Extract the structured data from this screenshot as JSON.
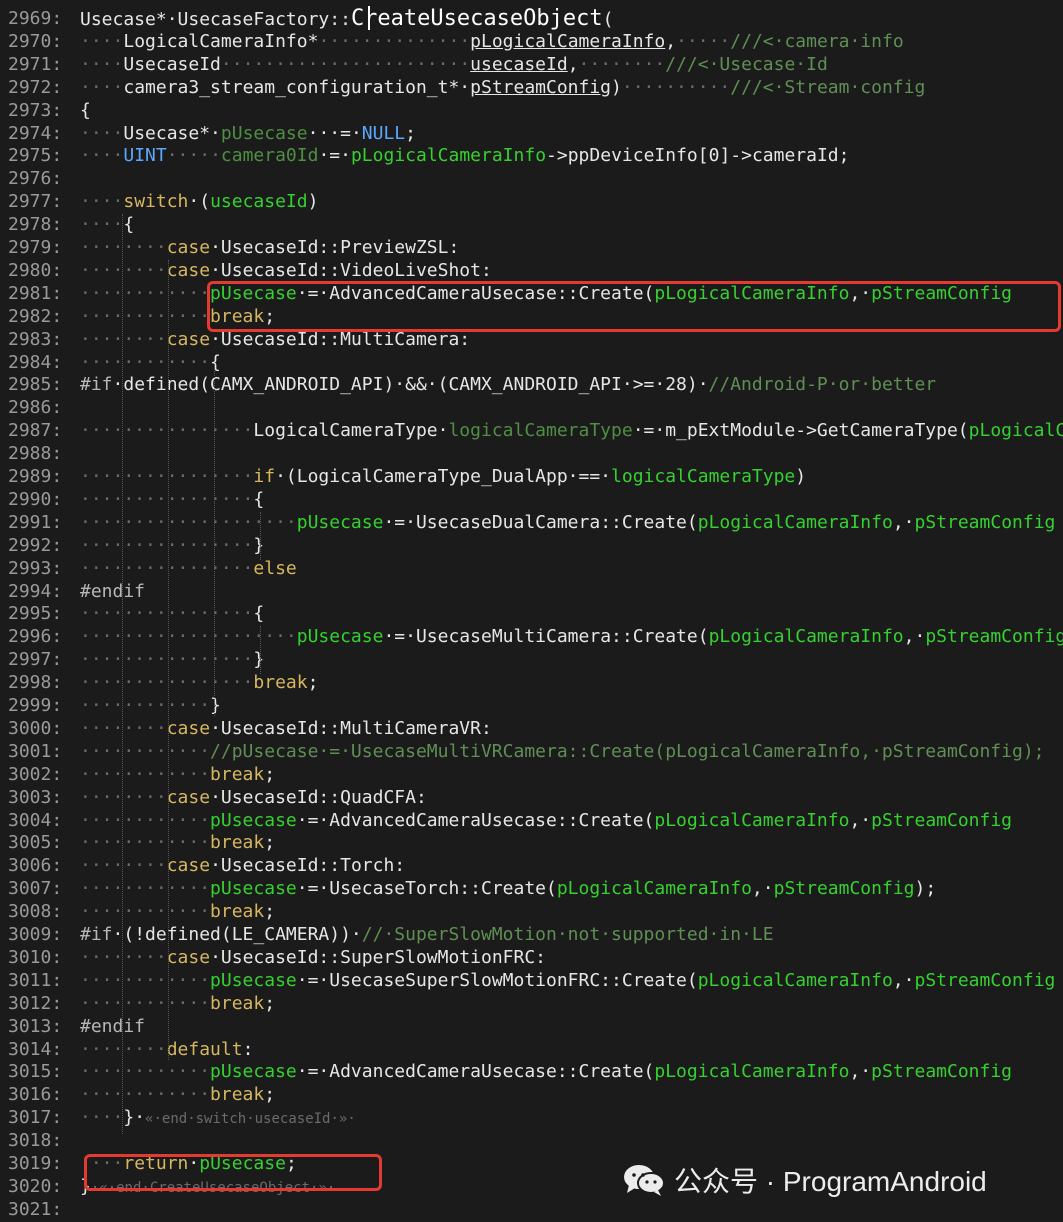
{
  "lines": [
    {
      "n": "2969:",
      "t": [
        [
          "Usecase*·UsecaseFactory::",
          ""
        ],
        [
          "CreateUsecaseObject",
          "t-title"
        ],
        [
          "(",
          ""
        ]
      ]
    },
    {
      "n": "2970:",
      "t": [
        [
          "····",
          "t-ws"
        ],
        [
          "LogicalCameraInfo*",
          ""
        ],
        [
          "··············",
          "t-ws"
        ],
        [
          "pLogicalCameraInfo",
          "t-u"
        ],
        [
          ",",
          ""
        ],
        [
          "·····",
          "t-ws"
        ],
        [
          "///<·camera·info",
          "t-cmt"
        ]
      ]
    },
    {
      "n": "2971:",
      "t": [
        [
          "····",
          "t-ws"
        ],
        [
          "UsecaseId",
          ""
        ],
        [
          "·······················",
          "t-ws"
        ],
        [
          "usecaseId",
          "t-u"
        ],
        [
          ",",
          ""
        ],
        [
          "········",
          "t-ws"
        ],
        [
          "///<·Usecase·Id",
          "t-cmt"
        ]
      ]
    },
    {
      "n": "2972:",
      "t": [
        [
          "····",
          "t-ws"
        ],
        [
          "camera3_stream_configuration_t*·",
          ""
        ],
        [
          "pStreamConfig",
          "t-u"
        ],
        [
          ")",
          ""
        ],
        [
          "··········",
          "t-ws"
        ],
        [
          "///<·Stream·config",
          "t-cmt"
        ]
      ]
    },
    {
      "n": "2973:",
      "t": [
        [
          "{",
          ""
        ]
      ]
    },
    {
      "n": "2974:",
      "t": [
        [
          "····",
          "t-ws"
        ],
        [
          "Usecase*·",
          ""
        ],
        [
          "pUsecase",
          "t-dim"
        ],
        [
          "···=·",
          ""
        ],
        [
          "NULL",
          "t-type"
        ],
        [
          ";",
          ""
        ]
      ]
    },
    {
      "n": "2975:",
      "t": [
        [
          "····",
          "t-ws"
        ],
        [
          "UINT",
          "t-type"
        ],
        [
          "·····",
          "t-ws"
        ],
        [
          "camera0Id",
          "t-dim"
        ],
        [
          "·=·",
          ""
        ],
        [
          "pLogicalCameraInfo",
          "t-var"
        ],
        [
          "->ppDeviceInfo[0]->cameraId;",
          ""
        ]
      ]
    },
    {
      "n": "2976:",
      "t": []
    },
    {
      "n": "2977:",
      "t": [
        [
          "····",
          "t-ws"
        ],
        [
          "switch",
          "t-kw"
        ],
        [
          "·(",
          ""
        ],
        [
          "usecaseId",
          "t-var"
        ],
        [
          ")",
          ""
        ]
      ]
    },
    {
      "n": "2978:",
      "t": [
        [
          "····",
          "t-ws"
        ],
        [
          "{",
          ""
        ]
      ]
    },
    {
      "n": "2979:",
      "t": [
        [
          "········",
          "t-ws"
        ],
        [
          "case",
          "t-kw"
        ],
        [
          "·UsecaseId::PreviewZSL:",
          ""
        ]
      ]
    },
    {
      "n": "2980:",
      "t": [
        [
          "········",
          "t-ws"
        ],
        [
          "case",
          "t-kw"
        ],
        [
          "·UsecaseId::VideoLiveShot:",
          ""
        ]
      ]
    },
    {
      "n": "2981:",
      "t": [
        [
          "············",
          "t-ws"
        ],
        [
          "pUsecase",
          "t-var"
        ],
        [
          "·=·AdvancedCameraUsecase::Create(",
          ""
        ],
        [
          "pLogicalCameraInfo",
          "t-var"
        ],
        [
          ",·",
          ""
        ],
        [
          "pStreamConfig",
          "t-var"
        ]
      ]
    },
    {
      "n": "2982:",
      "t": [
        [
          "············",
          "t-ws"
        ],
        [
          "break",
          "t-kw"
        ],
        [
          ";",
          ""
        ]
      ]
    },
    {
      "n": "2983:",
      "t": [
        [
          "········",
          "t-ws"
        ],
        [
          "case",
          "t-kw"
        ],
        [
          "·UsecaseId::MultiCamera:",
          ""
        ]
      ]
    },
    {
      "n": "2984:",
      "t": [
        [
          "············",
          "t-ws"
        ],
        [
          "{",
          ""
        ]
      ]
    },
    {
      "n": "2985:",
      "t": [
        [
          "#if",
          "t-pp"
        ],
        [
          "·defined(CAMX_ANDROID_API)·&&·(CAMX_ANDROID_API·>=·28)·",
          ""
        ],
        [
          "//Android-P·or·better",
          "t-cmt"
        ]
      ]
    },
    {
      "n": "2986:",
      "t": []
    },
    {
      "n": "2987:",
      "t": [
        [
          "················",
          "t-ws"
        ],
        [
          "LogicalCameraType·",
          ""
        ],
        [
          "logicalCameraType",
          "t-dim"
        ],
        [
          "·=·m_pExtModule->GetCameraType(",
          ""
        ],
        [
          "pLogicalCameraInfo",
          "t-var"
        ]
      ]
    },
    {
      "n": "2988:",
      "t": []
    },
    {
      "n": "2989:",
      "t": [
        [
          "················",
          "t-ws"
        ],
        [
          "if",
          "t-kw"
        ],
        [
          "·(LogicalCameraType_DualApp·==·",
          ""
        ],
        [
          "logicalCameraType",
          "t-var"
        ],
        [
          ")",
          ""
        ]
      ]
    },
    {
      "n": "2990:",
      "t": [
        [
          "················",
          "t-ws"
        ],
        [
          "{",
          ""
        ]
      ]
    },
    {
      "n": "2991:",
      "t": [
        [
          "····················",
          "t-ws"
        ],
        [
          "pUsecase",
          "t-var"
        ],
        [
          "·=·UsecaseDualCamera::Create(",
          ""
        ],
        [
          "pLogicalCameraInfo",
          "t-var"
        ],
        [
          ",·",
          ""
        ],
        [
          "pStreamConfig",
          "t-var"
        ]
      ]
    },
    {
      "n": "2992:",
      "t": [
        [
          "················",
          "t-ws"
        ],
        [
          "}",
          ""
        ]
      ]
    },
    {
      "n": "2993:",
      "t": [
        [
          "················",
          "t-ws"
        ],
        [
          "else",
          "t-kw"
        ]
      ]
    },
    {
      "n": "2994:",
      "t": [
        [
          "#endif",
          "t-pp"
        ]
      ]
    },
    {
      "n": "2995:",
      "t": [
        [
          "················",
          "t-ws"
        ],
        [
          "{",
          ""
        ]
      ]
    },
    {
      "n": "2996:",
      "t": [
        [
          "····················",
          "t-ws"
        ],
        [
          "pUsecase",
          "t-var"
        ],
        [
          "·=·UsecaseMultiCamera::Create(",
          ""
        ],
        [
          "pLogicalCameraInfo",
          "t-var"
        ],
        [
          ",·",
          ""
        ],
        [
          "pStreamConfig",
          "t-var"
        ]
      ]
    },
    {
      "n": "2997:",
      "t": [
        [
          "················",
          "t-ws"
        ],
        [
          "}",
          ""
        ]
      ]
    },
    {
      "n": "2998:",
      "t": [
        [
          "················",
          "t-ws"
        ],
        [
          "break",
          "t-kw"
        ],
        [
          ";",
          ""
        ]
      ]
    },
    {
      "n": "2999:",
      "t": [
        [
          "············",
          "t-ws"
        ],
        [
          "}",
          ""
        ]
      ]
    },
    {
      "n": "3000:",
      "t": [
        [
          "········",
          "t-ws"
        ],
        [
          "case",
          "t-kw"
        ],
        [
          "·UsecaseId::MultiCameraVR:",
          ""
        ]
      ]
    },
    {
      "n": "3001:",
      "t": [
        [
          "············",
          "t-ws"
        ],
        [
          "//pUsecase·=·UsecaseMultiVRCamera::Create(pLogicalCameraInfo,·pStreamConfig);",
          "t-cmt"
        ]
      ]
    },
    {
      "n": "3002:",
      "t": [
        [
          "············",
          "t-ws"
        ],
        [
          "break",
          "t-kw"
        ],
        [
          ";",
          ""
        ]
      ]
    },
    {
      "n": "3003:",
      "t": [
        [
          "········",
          "t-ws"
        ],
        [
          "case",
          "t-kw"
        ],
        [
          "·UsecaseId::QuadCFA:",
          ""
        ]
      ]
    },
    {
      "n": "3004:",
      "t": [
        [
          "············",
          "t-ws"
        ],
        [
          "pUsecase",
          "t-var"
        ],
        [
          "·=·AdvancedCameraUsecase::Create(",
          ""
        ],
        [
          "pLogicalCameraInfo",
          "t-var"
        ],
        [
          ",·",
          ""
        ],
        [
          "pStreamConfig",
          "t-var"
        ]
      ]
    },
    {
      "n": "3005:",
      "t": [
        [
          "············",
          "t-ws"
        ],
        [
          "break",
          "t-kw"
        ],
        [
          ";",
          ""
        ]
      ]
    },
    {
      "n": "3006:",
      "t": [
        [
          "········",
          "t-ws"
        ],
        [
          "case",
          "t-kw"
        ],
        [
          "·UsecaseId::Torch:",
          ""
        ]
      ]
    },
    {
      "n": "3007:",
      "t": [
        [
          "············",
          "t-ws"
        ],
        [
          "pUsecase",
          "t-var"
        ],
        [
          "·=·UsecaseTorch::Create(",
          ""
        ],
        [
          "pLogicalCameraInfo",
          "t-var"
        ],
        [
          ",·",
          ""
        ],
        [
          "pStreamConfig",
          "t-var"
        ],
        [
          ");",
          ""
        ]
      ]
    },
    {
      "n": "3008:",
      "t": [
        [
          "············",
          "t-ws"
        ],
        [
          "break",
          "t-kw"
        ],
        [
          ";",
          ""
        ]
      ]
    },
    {
      "n": "3009:",
      "t": [
        [
          "#if",
          "t-pp"
        ],
        [
          "·(!defined(LE_CAMERA))·",
          ""
        ],
        [
          "//·SuperSlowMotion·not·supported·in·LE",
          "t-cmt"
        ]
      ]
    },
    {
      "n": "3010:",
      "t": [
        [
          "········",
          "t-ws"
        ],
        [
          "case",
          "t-kw"
        ],
        [
          "·UsecaseId::SuperSlowMotionFRC:",
          ""
        ]
      ]
    },
    {
      "n": "3011:",
      "t": [
        [
          "············",
          "t-ws"
        ],
        [
          "pUsecase",
          "t-var"
        ],
        [
          "·=·UsecaseSuperSlowMotionFRC::Create(",
          ""
        ],
        [
          "pLogicalCameraInfo",
          "t-var"
        ],
        [
          ",·",
          ""
        ],
        [
          "pStreamConfig",
          "t-var"
        ]
      ]
    },
    {
      "n": "3012:",
      "t": [
        [
          "············",
          "t-ws"
        ],
        [
          "break",
          "t-kw"
        ],
        [
          ";",
          ""
        ]
      ]
    },
    {
      "n": "3013:",
      "t": [
        [
          "#endif",
          "t-pp"
        ]
      ]
    },
    {
      "n": "3014:",
      "t": [
        [
          "········",
          "t-ws"
        ],
        [
          "default",
          "t-kw"
        ],
        [
          ":",
          ""
        ]
      ]
    },
    {
      "n": "3015:",
      "t": [
        [
          "············",
          "t-ws"
        ],
        [
          "pUsecase",
          "t-var"
        ],
        [
          "·=·AdvancedCameraUsecase::Create(",
          ""
        ],
        [
          "pLogicalCameraInfo",
          "t-var"
        ],
        [
          ",·",
          ""
        ],
        [
          "pStreamConfig",
          "t-var"
        ]
      ]
    },
    {
      "n": "3016:",
      "t": [
        [
          "············",
          "t-ws"
        ],
        [
          "break",
          "t-kw"
        ],
        [
          ";",
          ""
        ]
      ]
    },
    {
      "n": "3017:",
      "t": [
        [
          "····",
          "t-ws"
        ],
        [
          "}·",
          ""
        ],
        [
          "«·end·switch·usecaseId·»·",
          "t-tag"
        ]
      ]
    },
    {
      "n": "3018:",
      "t": []
    },
    {
      "n": "3019:",
      "t": [
        [
          "····",
          "t-ws"
        ],
        [
          "return",
          "t-kw"
        ],
        [
          "·",
          ""
        ],
        [
          "pUsecase",
          "t-var"
        ],
        [
          ";",
          ""
        ]
      ]
    },
    {
      "n": "3020:",
      "t": [
        [
          "}",
          ""
        ],
        [
          "·«·end·CreateUsecaseObject·»·",
          "t-tag"
        ]
      ]
    },
    {
      "n": "3021:",
      "t": []
    }
  ],
  "watermark": {
    "text": "公众号 · ProgramAndroid",
    "icon": "wechat-icon"
  },
  "colors": {
    "background": "#1b1b1b",
    "highlight_box": "#e33a31",
    "keyword": "#d7b75e",
    "variable": "#35d12f",
    "comment": "#5f8f54"
  }
}
